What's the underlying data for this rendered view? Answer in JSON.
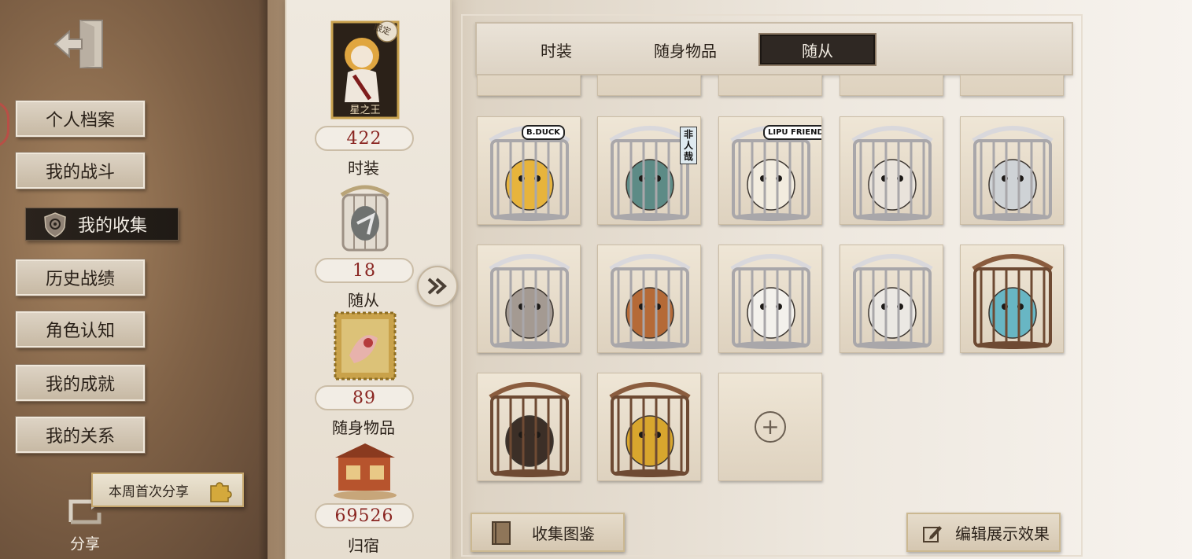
{
  "sidebar": {
    "menu": [
      {
        "label": "个人档案",
        "active": false
      },
      {
        "label": "我的战斗",
        "active": false
      },
      {
        "label": "我的收集",
        "active": true
      },
      {
        "label": "历史战绩",
        "active": false
      },
      {
        "label": "角色认知",
        "active": false
      },
      {
        "label": "我的成就",
        "active": false
      },
      {
        "label": "我的关系",
        "active": false
      }
    ],
    "share_tip": "本周首次分享",
    "share_label": "分享"
  },
  "stats": {
    "featured_badge": "限定",
    "featured_name": "星之王",
    "items": [
      {
        "value": "422",
        "label": "时装"
      },
      {
        "value": "18",
        "label": "随从"
      },
      {
        "value": "89",
        "label": "随身物品"
      },
      {
        "value": "69526",
        "label": "归宿"
      }
    ]
  },
  "tabs": [
    {
      "label": "时装",
      "active": false
    },
    {
      "label": "随身物品",
      "active": false
    },
    {
      "label": "随从",
      "active": true
    }
  ],
  "pets": [
    {
      "name": "duck",
      "sticker": "B.DUCK",
      "body": "#e7b43c",
      "cage": "silver"
    },
    {
      "name": "beast",
      "sticker": "非人哉",
      "body": "#5d8b86",
      "cage": "silver"
    },
    {
      "name": "ghost",
      "sticker": "LIPU FRIENDS",
      "body": "#f2ecdf",
      "cage": "silver"
    },
    {
      "name": "cat",
      "sticker": "",
      "body": "#e9e3db",
      "cage": "silver"
    },
    {
      "name": "horse",
      "sticker": "",
      "body": "#cfd3d6",
      "cage": "silver"
    },
    {
      "name": "crown-cat",
      "sticker": "",
      "body": "#a49a92",
      "cage": "silver"
    },
    {
      "name": "fox",
      "sticker": "",
      "body": "#b56a37",
      "cage": "silver"
    },
    {
      "name": "panda",
      "sticker": "",
      "body": "#f3f1ec",
      "cage": "silver"
    },
    {
      "name": "rabbit",
      "sticker": "",
      "body": "#ebe8e3",
      "cage": "silver"
    },
    {
      "name": "butterfly",
      "sticker": "",
      "body": "#68b6c4",
      "cage": "bronze"
    },
    {
      "name": "clock",
      "sticker": "",
      "body": "#3c2f27",
      "cage": "bronze"
    },
    {
      "name": "gramophone",
      "sticker": "",
      "body": "#d8a62e",
      "cage": "bronze"
    }
  ],
  "add_slot": "+",
  "buttons": {
    "catalog": "收集图鉴",
    "edit_display": "编辑展示效果"
  },
  "colors": {
    "value_red": "#8a2622",
    "active_tab": "#2f2823",
    "gold_border": "#c5a66c"
  }
}
